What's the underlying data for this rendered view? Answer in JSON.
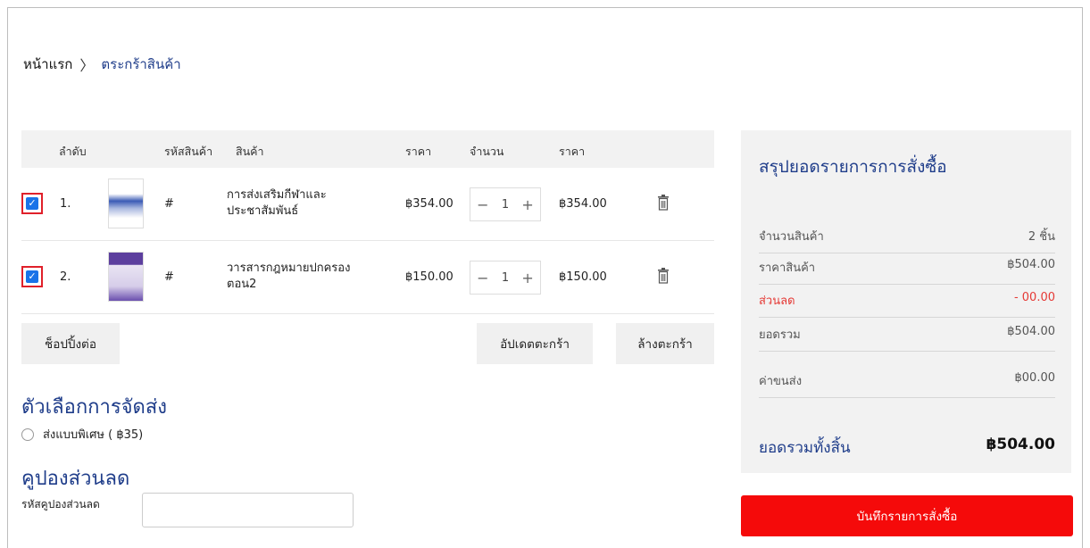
{
  "breadcrumb": {
    "home": "หน้าแรก",
    "separator": "〉",
    "current": "ตระกร้าสินค้า"
  },
  "table": {
    "headers": {
      "order": "ลำดับ",
      "sku": "รหัสสินค้า",
      "product": "สินค้า",
      "price": "ราคา",
      "qty": "จำนวน",
      "total": "ราคา"
    },
    "rows": [
      {
        "index": "1.",
        "sku": "#",
        "name": "การส่งเสริมกีฬาและประชาสัมพันธ์",
        "price": "฿354.00",
        "qty": "1",
        "total": "฿354.00",
        "checked": true
      },
      {
        "index": "2.",
        "sku": "#",
        "name": "วารสารกฎหมายปกครอง ตอน2",
        "price": "฿150.00",
        "qty": "1",
        "total": "฿150.00",
        "checked": true
      }
    ],
    "qty_minus": "−",
    "qty_plus": "+"
  },
  "actions": {
    "continue_shopping": "ช็อปปิ้งต่อ",
    "update_cart": "อัปเดตตะกร้า",
    "clear_cart": "ล้างตะกร้า"
  },
  "shipping": {
    "title": "ตัวเลือกการจัดส่ง",
    "option_label": "ส่งแบบพิเศษ ( ฿35)"
  },
  "coupon": {
    "title": "คูปองส่วนลด",
    "label": "รหัสคูปองส่วนลด",
    "value": ""
  },
  "summary": {
    "title": "สรุปยอดรายการการสั่งซื้อ",
    "items_label": "จำนวนสินค้า",
    "items_value": "2 ชิ้น",
    "price_label": "ราคาสินค้า",
    "price_value": "฿504.00",
    "discount_label": "ส่วนลด",
    "discount_value": "- 00.00",
    "subtotal_label": "ยอดรวม",
    "subtotal_value": "฿504.00",
    "shipping_label": "ค่าขนส่ง",
    "shipping_value": "฿00.00",
    "grand_label": "ยอดรวมทั้งสิ้น",
    "grand_value": "฿504.00"
  },
  "submit_label": "บันทึกรายการสั่งซื้อ",
  "colors": {
    "accent_blue": "#1f3d8a",
    "checkbox_blue": "#1a73e8",
    "submit_red": "#f50a0a",
    "discount_red": "#e53935"
  }
}
